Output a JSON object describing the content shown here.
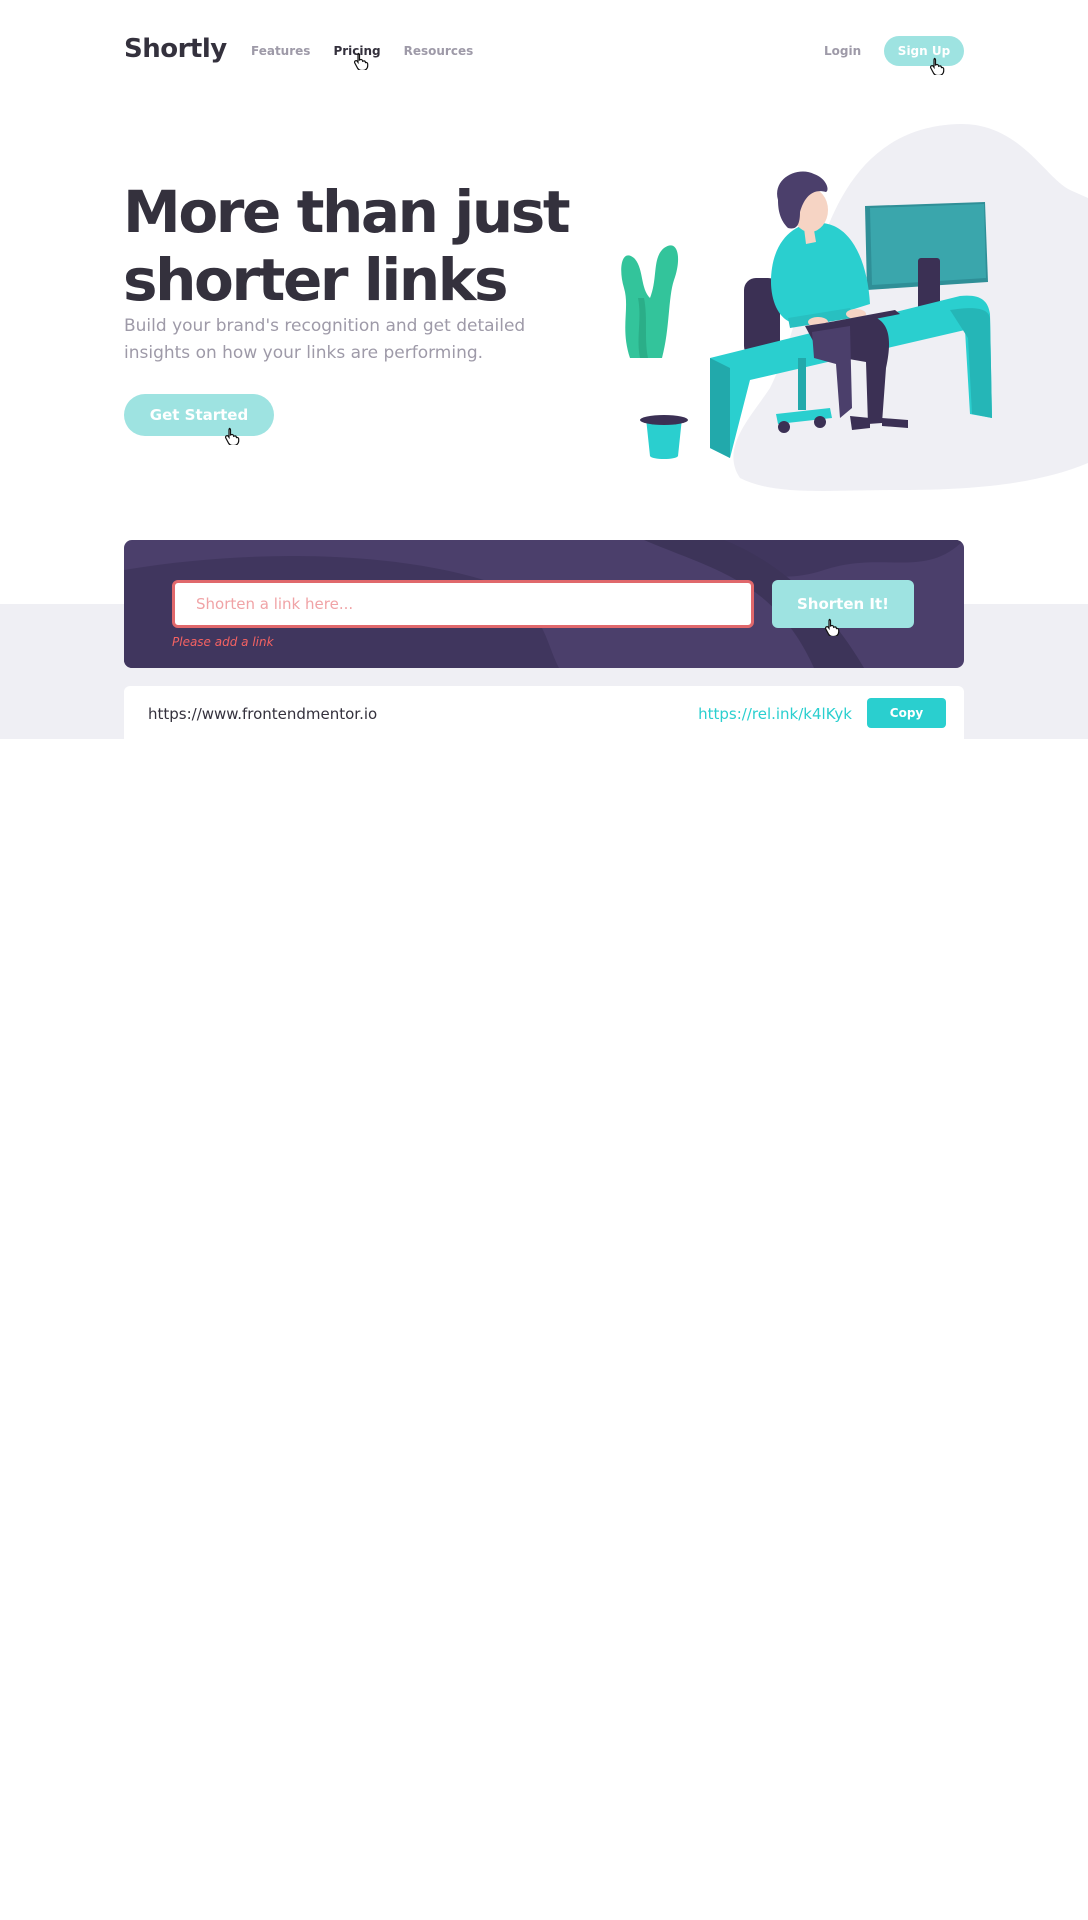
{
  "header": {
    "logo": "Shortly",
    "nav": [
      "Features",
      "Pricing",
      "Resources"
    ],
    "login_label": "Login",
    "signup_label": "Sign Up"
  },
  "hero": {
    "title_line1": "More than just",
    "title_line2": "shorter links",
    "subtitle": "Build your brand's recognition and get detailed insights on how your links are performing.",
    "cta_label": "Get Started"
  },
  "shortener": {
    "input_placeholder": "Shorten a link here...",
    "input_value": "",
    "error_message": "Please add a link",
    "submit_label": "Shorten It!"
  },
  "results": [
    {
      "original": "https://www.frontendmentor.io",
      "short": "https://rel.ink/k4lKyk",
      "copy_label": "Copy"
    }
  ],
  "colors": {
    "brand_cyan": "#2acfcf",
    "cyan_light": "#9ee3e1",
    "dark_violet": "#4b3f6b",
    "error_red": "#f46262",
    "text_dark": "#34313d",
    "text_gray": "#9e9aa8",
    "band_gray": "#efeff4"
  },
  "icons": [
    "pointer-hand-icon"
  ]
}
